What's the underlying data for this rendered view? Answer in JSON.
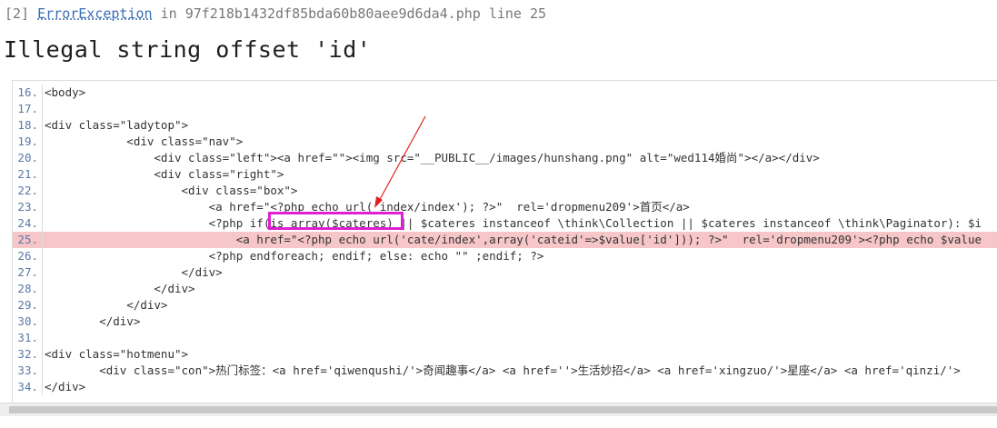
{
  "header": {
    "error_index": "[2]",
    "error_class": "ErrorException",
    "in_text": " in ",
    "file": "97f218b1432df85bda60b80aee9d6da4.php",
    "line_label": " line 25"
  },
  "title": "Illegal string offset 'id'",
  "source_lines": [
    {
      "num": "16.",
      "text": "<body>",
      "highlight": false
    },
    {
      "num": "17.",
      "text": "",
      "highlight": false
    },
    {
      "num": "18.",
      "text": "<div class=\"ladytop\">",
      "highlight": false
    },
    {
      "num": "19.",
      "text": "            <div class=\"nav\">",
      "highlight": false
    },
    {
      "num": "20.",
      "text": "                <div class=\"left\"><a href=\"\"><img src=\"__PUBLIC__/images/hunshang.png\" alt=\"wed114婚尚\"></a></div>",
      "highlight": false
    },
    {
      "num": "21.",
      "text": "                <div class=\"right\">",
      "highlight": false
    },
    {
      "num": "22.",
      "text": "                    <div class=\"box\">",
      "highlight": false
    },
    {
      "num": "23.",
      "text": "                        <a href=\"<?php echo url('index/index'); ?>\"  rel='dropmenu209'>首页</a>",
      "highlight": false
    },
    {
      "num": "24.",
      "text": "                        <?php if(is_array($cateres) || $cateres instanceof \\think\\Collection || $cateres instanceof \\think\\Paginator): $i",
      "highlight": false
    },
    {
      "num": "25.",
      "text": "                            <a href=\"<?php echo url('cate/index',array('cateid'=>$value['id'])); ?>\"  rel='dropmenu209'><?php echo $value",
      "highlight": true
    },
    {
      "num": "26.",
      "text": "                        <?php endforeach; endif; else: echo \"\" ;endif; ?>",
      "highlight": false
    },
    {
      "num": "27.",
      "text": "                    </div>",
      "highlight": false
    },
    {
      "num": "28.",
      "text": "                </div>",
      "highlight": false
    },
    {
      "num": "29.",
      "text": "            </div>",
      "highlight": false
    },
    {
      "num": "30.",
      "text": "        </div>",
      "highlight": false
    },
    {
      "num": "31.",
      "text": "",
      "highlight": false
    },
    {
      "num": "32.",
      "text": "<div class=\"hotmenu\">",
      "highlight": false
    },
    {
      "num": "33.",
      "text": "        <div class=\"con\">热门标签：<a href='qiwenqushi/'>奇闻趣事</a> <a href=''>生活妙招</a> <a href='xingzuo/'>星座</a> <a href='qinzi/'>",
      "highlight": false
    },
    {
      "num": "34.",
      "text": "</div>",
      "highlight": false
    }
  ],
  "colors": {
    "highlight_row": "#f6c6c8",
    "annotation_box": "#e020d0",
    "annotation_arrow": "#e02020"
  }
}
